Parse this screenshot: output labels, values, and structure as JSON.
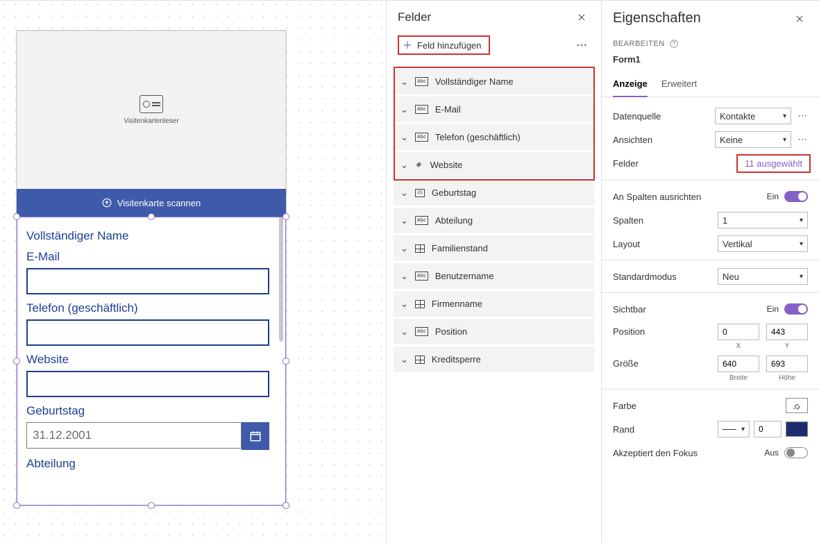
{
  "canvas": {
    "card_reader_label": "Visitenkartenleser",
    "scan_button": "Visitenkarte scannen",
    "form": {
      "fullname_label": "Vollständiger Name",
      "email_label": "E-Mail",
      "phone_label": "Telefon (geschäftlich)",
      "website_label": "Website",
      "birthday_label": "Geburtstag",
      "birthday_value": "31.12.2001",
      "department_label": "Abteilung"
    }
  },
  "fieldsPanel": {
    "title": "Felder",
    "add_label": "Feld hinzufügen",
    "items": [
      {
        "type": "abc",
        "label": "Vollständiger Name"
      },
      {
        "type": "abc",
        "label": "E-Mail"
      },
      {
        "type": "abc",
        "label": "Telefon (geschäftlich)"
      },
      {
        "type": "link",
        "label": "Website"
      },
      {
        "type": "date",
        "label": "Geburtstag"
      },
      {
        "type": "abc",
        "label": "Abteilung"
      },
      {
        "type": "grid",
        "label": "Familienstand"
      },
      {
        "type": "abc",
        "label": "Benutzername"
      },
      {
        "type": "grid",
        "label": "Firmenname"
      },
      {
        "type": "abc",
        "label": "Position"
      },
      {
        "type": "grid",
        "label": "Kreditsperre"
      }
    ]
  },
  "props": {
    "title": "Eigenschaften",
    "edit_label": "BEARBEITEN",
    "form_name": "Form1",
    "tab_display": "Anzeige",
    "tab_advanced": "Erweitert",
    "datasource_label": "Datenquelle",
    "datasource_value": "Kontakte",
    "views_label": "Ansichten",
    "views_value": "Keine",
    "fields_label": "Felder",
    "fields_selected": "11 ausgewählt",
    "snap_label": "An Spalten ausrichten",
    "snap_state": "Ein",
    "columns_label": "Spalten",
    "columns_value": "1",
    "layout_label": "Layout",
    "layout_value": "Vertikal",
    "defaultmode_label": "Standardmodus",
    "defaultmode_value": "Neu",
    "visible_label": "Sichtbar",
    "visible_state": "Ein",
    "position_label": "Position",
    "pos_x": "0",
    "pos_y": "443",
    "pos_xlbl": "X",
    "pos_ylbl": "Y",
    "size_label": "Größe",
    "size_w": "640",
    "size_h": "693",
    "size_wlbl": "Breite",
    "size_hlbl": "Höhe",
    "color_label": "Farbe",
    "border_label": "Rand",
    "border_value": "0",
    "focus_label": "Akzeptiert den Fokus",
    "focus_state": "Aus"
  }
}
